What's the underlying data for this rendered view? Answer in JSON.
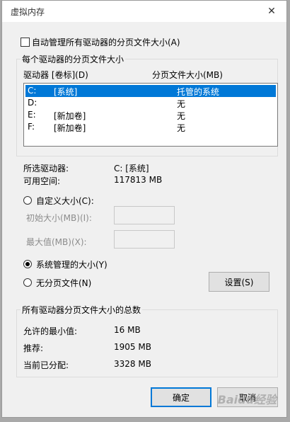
{
  "window": {
    "title": "虚拟内存",
    "close_glyph": "✕"
  },
  "auto_manage": {
    "label": "自动管理所有驱动器的分页文件大小(A)",
    "checked": false
  },
  "per_drive_group": {
    "legend": "每个驱动器的分页文件大小",
    "columns": {
      "drive": "驱动器 [卷标](D)",
      "size": "分页文件大小(MB)"
    },
    "rows": [
      {
        "drive": "C:",
        "label": "[系统]",
        "size": "托管的系统",
        "selected": true
      },
      {
        "drive": "D:",
        "label": "",
        "size": "无",
        "selected": false
      },
      {
        "drive": "E:",
        "label": "[新加卷]",
        "size": "无",
        "selected": false
      },
      {
        "drive": "F:",
        "label": "[新加卷]",
        "size": "无",
        "selected": false
      }
    ]
  },
  "selected_drive": {
    "label": "所选驱动器:",
    "value": "C:  [系统]"
  },
  "free_space": {
    "label": "可用空间:",
    "value": "117813 MB"
  },
  "custom_size": {
    "label": "自定义大小(C):",
    "initial_label": "初始大小(MB)(I):",
    "max_label": "最大值(MB)(X):"
  },
  "system_managed": {
    "label": "系统管理的大小(Y)",
    "selected": true
  },
  "no_paging": {
    "label": "无分页文件(N)"
  },
  "set_button": "设置(S)",
  "totals_group": {
    "legend": "所有驱动器分页文件大小的总数",
    "min_label": "允许的最小值:",
    "min_value": "16 MB",
    "recommended_label": "推荐:",
    "recommended_value": "1905 MB",
    "allocated_label": "当前已分配:",
    "allocated_value": "3328 MB"
  },
  "buttons": {
    "ok": "确定",
    "cancel": "取消"
  },
  "watermark": "Baidu经验",
  "colors": {
    "selection": "#0078d7",
    "dialog_bg": "#f0f0f0"
  }
}
